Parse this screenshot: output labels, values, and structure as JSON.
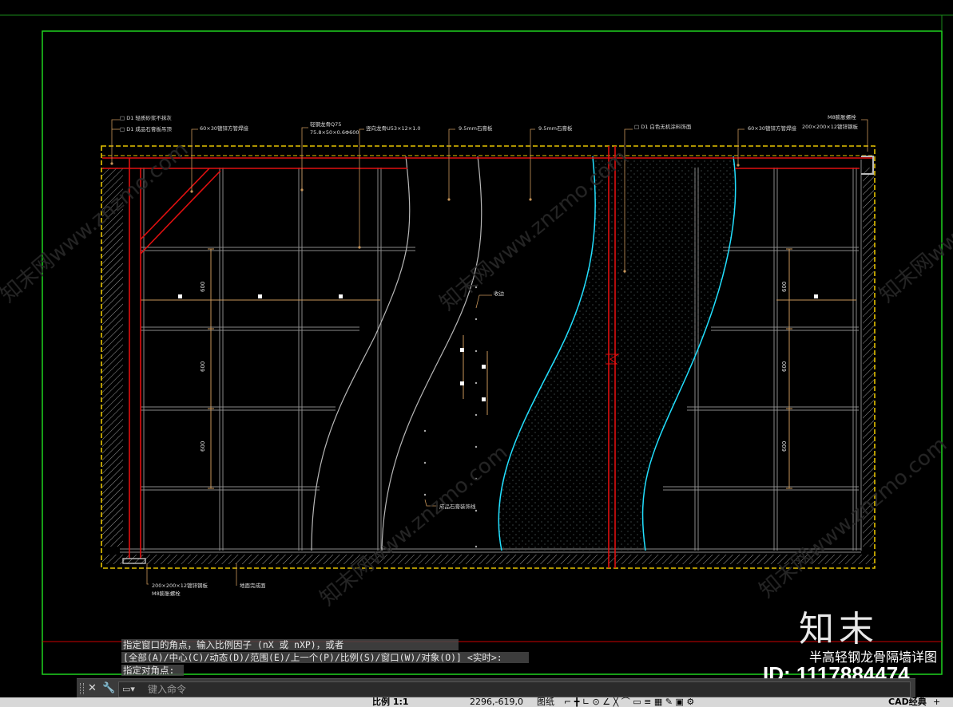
{
  "annotations": {
    "top_left_1": "□ D1 轻质砂浆不抹灰",
    "top_left_2": "□ D1 成品石膏板吊顶",
    "tube1": "60×30镀锌方管焊接",
    "keel1": "轻钢龙骨Q75",
    "keel1b": "75.8×50×0.6Φ600",
    "keel2": "竖向龙骨U53×12×1.0",
    "board1": "9.5mm石膏板",
    "board2": "9.5mm石膏板",
    "paint": "□ D1 白色无机涂料饰面",
    "tube2": "60×30镀锌方管焊接",
    "plate_top": "200×200×12镀锌钢板",
    "bolt_top": "M8膨胀螺栓",
    "center_label": "收边",
    "mid_label": "成品石膏装饰线",
    "bottom_left_1": "200×200×12镀锌钢板",
    "bottom_left_2": "M8膨胀螺栓",
    "bottom_mid": "地面完成面",
    "dim_left_1": "600",
    "dim_left_2": "600",
    "dim_left_3": "600",
    "dim_right_1": "600",
    "dim_right_2": "600",
    "dim_right_3": "600"
  },
  "command": {
    "history_1": "指定窗口的角点，输入比例因子 (nX 或 nXP)，或者",
    "history_2": "[全部(A)/中心(C)/动态(D)/范围(E)/上一个(P)/比例(S)/窗口(W)/对象(O)] <实时>:",
    "history_3": "指定对角点:",
    "placeholder": "键入命令",
    "close_icon": "close-icon",
    "settings_icon": "wrench-icon"
  },
  "status": {
    "scale": "比例 1:1",
    "coords": "2296,-619,0",
    "space": "图纸",
    "workspace": "CAD经典"
  },
  "watermark": {
    "logo": "知末",
    "title": "半高轻钢龙骨隔墙详图",
    "id": "ID: 1117884474",
    "diag_text": "知末网www.znzmo.com"
  },
  "colors": {
    "frame_green": "#1fd21f",
    "border_yellow": "#e6c200",
    "steel_red": "#e01010",
    "wave_cyan": "#22e0ff",
    "grid_gray": "#8a8a8a",
    "leader_orange": "#c8965a"
  }
}
